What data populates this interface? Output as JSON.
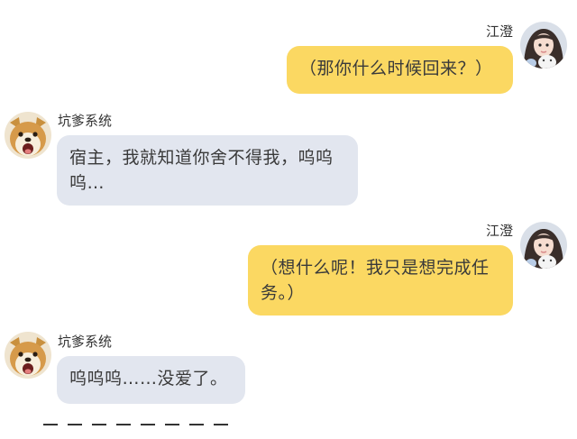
{
  "messages": [
    {
      "sender": "江澄",
      "side": "right",
      "avatar": "girl-avatar",
      "text": "（那你什么时候回来？）"
    },
    {
      "sender": "坑爹系统",
      "side": "left",
      "avatar": "shiba-dog-avatar",
      "text": "宿主，我就知道你舍不得我，呜呜呜…"
    },
    {
      "sender": "江澄",
      "side": "right",
      "avatar": "girl-avatar",
      "text": "（想什么呢！我只是想完成任务。）"
    },
    {
      "sender": "坑爹系统",
      "side": "left",
      "avatar": "shiba-dog-avatar",
      "text": "呜呜呜……没爱了。"
    }
  ],
  "footer": {
    "dash_count": 8
  },
  "colors": {
    "my_bubble": "#fbd862",
    "bot_bubble": "#e2e6ef",
    "background": "#ffffff"
  }
}
